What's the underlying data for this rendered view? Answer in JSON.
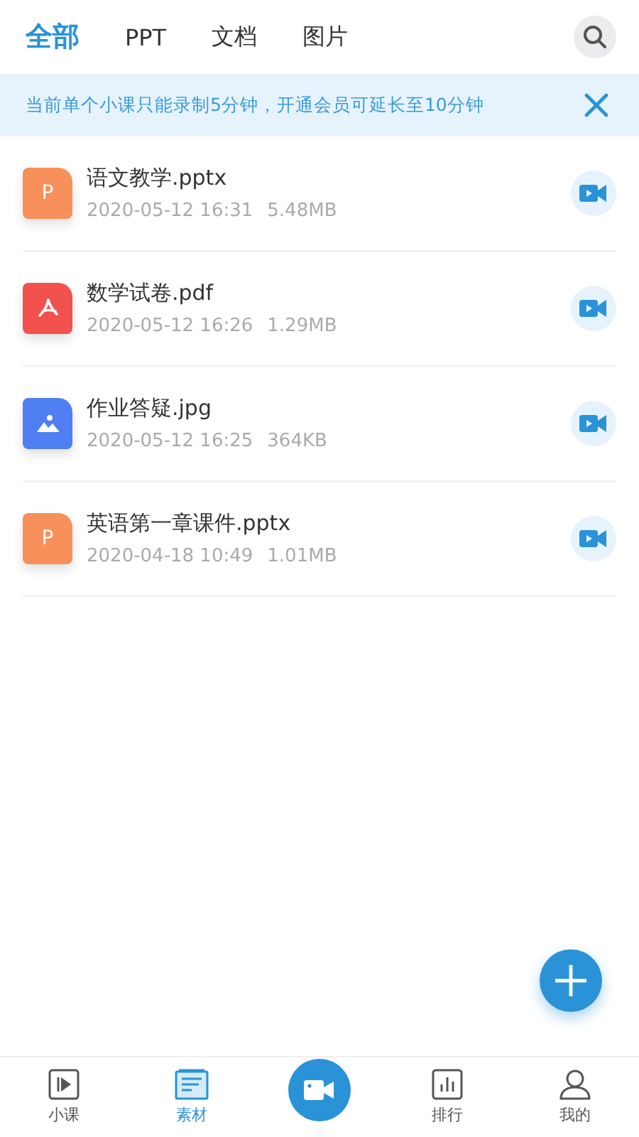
{
  "tabs": [
    {
      "label": "全部",
      "selected": true
    },
    {
      "label": "PPT",
      "selected": false
    },
    {
      "label": "文档",
      "selected": false
    },
    {
      "label": "图片",
      "selected": false
    }
  ],
  "notice": {
    "text": "当前单个小课只能录制5分钟，开通会员可延长至10分钟"
  },
  "files": [
    {
      "kind": "ppt",
      "name": "语文教学.pptx",
      "date": "2020-05-12 16:31",
      "size": "5.48MB",
      "badge": "P"
    },
    {
      "kind": "pdf",
      "name": "数学试卷.pdf",
      "date": "2020-05-12 16:26",
      "size": "1.29MB"
    },
    {
      "kind": "image",
      "name": "作业答疑.jpg",
      "date": "2020-05-12 16:25",
      "size": "364KB"
    },
    {
      "kind": "ppt",
      "name": "英语第一章课件.pptx",
      "date": "2020-04-18 10:49",
      "size": "1.01MB",
      "badge": "P"
    }
  ],
  "nav": [
    {
      "kind": "play",
      "label": "小课",
      "selected": false
    },
    {
      "kind": "doc",
      "label": "素材",
      "selected": true
    },
    {
      "kind": "record"
    },
    {
      "kind": "chart",
      "label": "排行",
      "selected": false
    },
    {
      "kind": "user",
      "label": "我的",
      "selected": false
    }
  ]
}
